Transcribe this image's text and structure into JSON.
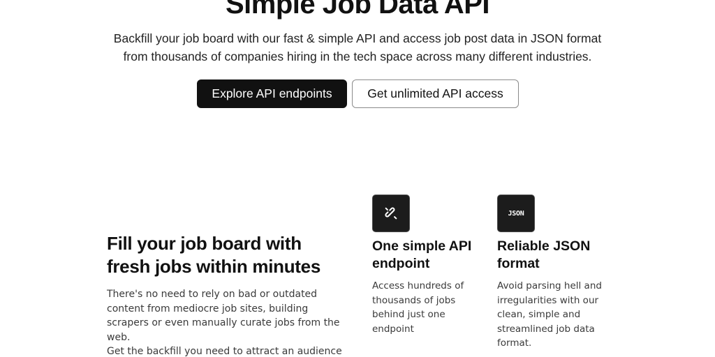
{
  "hero": {
    "title": "Simple Job Data API",
    "subtitle_line1": "Backfill your job board with our fast & simple API and access job post data in JSON format",
    "subtitle_line2": "from thousands of companies hiring in the tech space across many different industries.",
    "primary_button": "Explore API endpoints",
    "secondary_button": "Get unlimited API access"
  },
  "section": {
    "heading_line1": "Fill your job board with",
    "heading_line2": "fresh jobs within minutes",
    "paragraph1": "There's no need to rely on bad or outdated content from mediocre job sites, building scrapers or even manually curate jobs from the web.",
    "paragraph2": "Get the backfill you need to attract an audience in"
  },
  "features": [
    {
      "icon": "link-icon",
      "title": "One simple API endpoint",
      "description": "Access hundreds of thousands of jobs behind just one endpoint"
    },
    {
      "icon": "json-icon",
      "icon_text": "JSON",
      "title": "Reliable JSON format",
      "description": "Avoid parsing hell and irregularities with our clean, simple and streamlined job data format."
    }
  ],
  "colors": {
    "text": "#111111",
    "muted_text": "#3a3a3a",
    "primary_button_bg": "#111111",
    "icon_bg": "#1c1c1c"
  }
}
